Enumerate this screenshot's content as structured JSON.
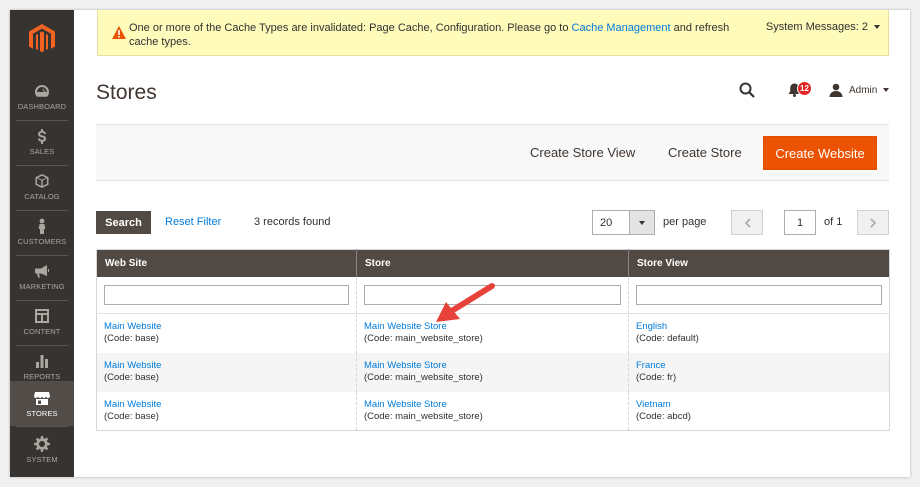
{
  "banner": {
    "message_before": "One or more of the Cache Types are invalidated: Page Cache, Configuration. Please go to ",
    "link": "Cache Management",
    "message_after": " and refresh cache types.",
    "system_messages": "System Messages: 2"
  },
  "sidebar": {
    "items": [
      {
        "label": "Dashboard",
        "icon": "dashboard-icon"
      },
      {
        "label": "Sales",
        "icon": "dollar-icon"
      },
      {
        "label": "Catalog",
        "icon": "cube-icon"
      },
      {
        "label": "Customers",
        "icon": "person-icon"
      },
      {
        "label": "Marketing",
        "icon": "megaphone-icon"
      },
      {
        "label": "Content",
        "icon": "layout-icon"
      },
      {
        "label": "Reports",
        "icon": "bar-chart-icon"
      },
      {
        "label": "Stores",
        "icon": "store-icon"
      },
      {
        "label": "System",
        "icon": "gear-icon"
      }
    ]
  },
  "header": {
    "title": "Stores",
    "notifications_count": "12",
    "user": "Admin"
  },
  "actions": {
    "create_store_view": "Create Store View",
    "create_store": "Create Store",
    "create_website": "Create Website"
  },
  "grid": {
    "search": "Search",
    "reset_filter": "Reset Filter",
    "records_found": "3 records found",
    "per_page_value": "20",
    "per_page_label": "per page",
    "page": "1",
    "of_pages": "of 1",
    "columns": [
      "Web Site",
      "Store",
      "Store View"
    ],
    "rows": [
      {
        "website": "Main Website",
        "website_code": "(Code: base)",
        "store": "Main Website Store",
        "store_code": "(Code: main_website_store)",
        "view": "English",
        "view_code": "(Code: default)"
      },
      {
        "website": "Main Website",
        "website_code": "(Code: base)",
        "store": "Main Website Store",
        "store_code": "(Code: main_website_store)",
        "view": "France",
        "view_code": "(Code: fr)"
      },
      {
        "website": "Main Website",
        "website_code": "(Code: base)",
        "store": "Main Website Store",
        "store_code": "(Code: main_website_store)",
        "view": "Vietnam",
        "view_code": "(Code: abcd)"
      }
    ]
  },
  "colors": {
    "sidebar": "#373330",
    "accent": "#eb5202",
    "link": "#007bdb",
    "header_row": "#514943",
    "banner": "#fffbbb",
    "annotation_arrow": "#e8433a"
  }
}
